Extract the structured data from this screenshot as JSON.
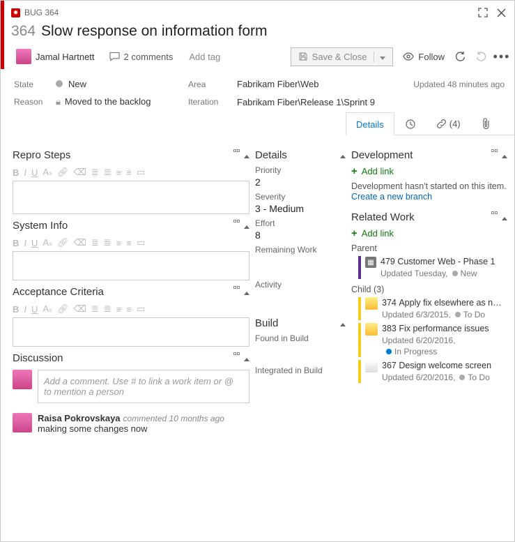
{
  "window": {
    "type_id": "BUG 364",
    "id": "364",
    "title": "Slow response on information form"
  },
  "header": {
    "assignee": "Jamal Hartnett",
    "comments_count": "2 comments",
    "add_tag": "Add tag",
    "save_close": "Save & Close",
    "follow": "Follow"
  },
  "meta": {
    "state_label": "State",
    "state_value": "New",
    "reason_label": "Reason",
    "reason_value": "Moved to the backlog",
    "area_label": "Area",
    "area_value": "Fabrikam Fiber\\Web",
    "iteration_label": "Iteration",
    "iteration_value": "Fabrikam Fiber\\Release 1\\Sprint 9",
    "updated": "Updated 48 minutes ago"
  },
  "tabs": {
    "details": "Details",
    "links_count": "(4)"
  },
  "left": {
    "repro": "Repro Steps",
    "sysinfo": "System Info",
    "acceptance": "Acceptance Criteria",
    "discussion": "Discussion",
    "comment_placeholder": "Add a comment. Use # to link a work item or @ to mention a person",
    "disc_name": "Raisa Pokrovskaya",
    "disc_meta": "commented 10 months ago",
    "disc_body": "making some changes now"
  },
  "mid": {
    "details": "Details",
    "priority_l": "Priority",
    "priority_v": "2",
    "severity_l": "Severity",
    "severity_v": "3 - Medium",
    "effort_l": "Effort",
    "effort_v": "8",
    "remaining_l": "Remaining Work",
    "activity_l": "Activity",
    "build": "Build",
    "found_l": "Found in Build",
    "integrated_l": "Integrated in Build"
  },
  "right": {
    "development": "Development",
    "add_link": "Add link",
    "dev_empty": "Development hasn't started on this item.",
    "create_branch": "Create a new branch",
    "related": "Related Work",
    "parent_l": "Parent",
    "parent_id": "479",
    "parent_title": "Customer Web - Phase 1",
    "parent_sub": "Updated Tuesday,",
    "parent_state": "New",
    "child_l": "Child (3)",
    "c1_id": "374",
    "c1_title": "Apply fix elsewhere as needed",
    "c1_sub": "Updated 6/3/2015,",
    "c1_state": "To Do",
    "c2_id": "383",
    "c2_title": "Fix performance issues",
    "c2_sub": "Updated 6/20/2016,",
    "c2_state": "In Progress",
    "c3_id": "367",
    "c3_title": "Design welcome screen",
    "c3_sub": "Updated 6/20/2016,",
    "c3_state": "To Do"
  }
}
